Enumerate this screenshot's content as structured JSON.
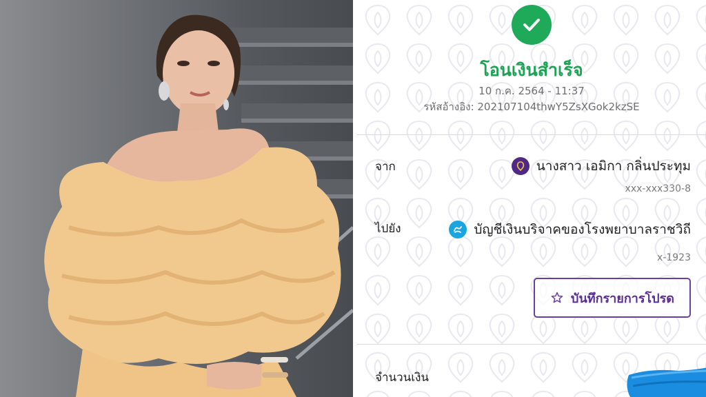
{
  "slip": {
    "status_title": "โอนเงินสำเร็จ",
    "datetime": "10 ก.ค. 2564 - 11:37",
    "reference": "รหัสอ้างอิง: 202107104thwY5ZsXGok2kzSE",
    "from": {
      "label": "จาก",
      "name": "นางสาว เอมิกา กลิ่นประทุม",
      "account": "xxx-xxx330-8",
      "bank_icon": "scb-bank-icon"
    },
    "to": {
      "label": "ไปยัง",
      "name": "บัญชีเงินบริจาคของโรงพยาบาลราชวิถี",
      "account": "x-1923",
      "bank_icon": "ktb-bank-icon"
    },
    "favorite_button": "บันทึกรายการโปรด",
    "amount_label": "จำนวนเงิน"
  },
  "colors": {
    "success_green": "#1faa59",
    "title_green": "#1da354",
    "scb_purple": "#4e2a84",
    "ktb_blue": "#19a6e0",
    "button_purple": "#6a3ea1",
    "scribble_blue": "#1a8de0",
    "dress_peach": "#f1c98e"
  }
}
